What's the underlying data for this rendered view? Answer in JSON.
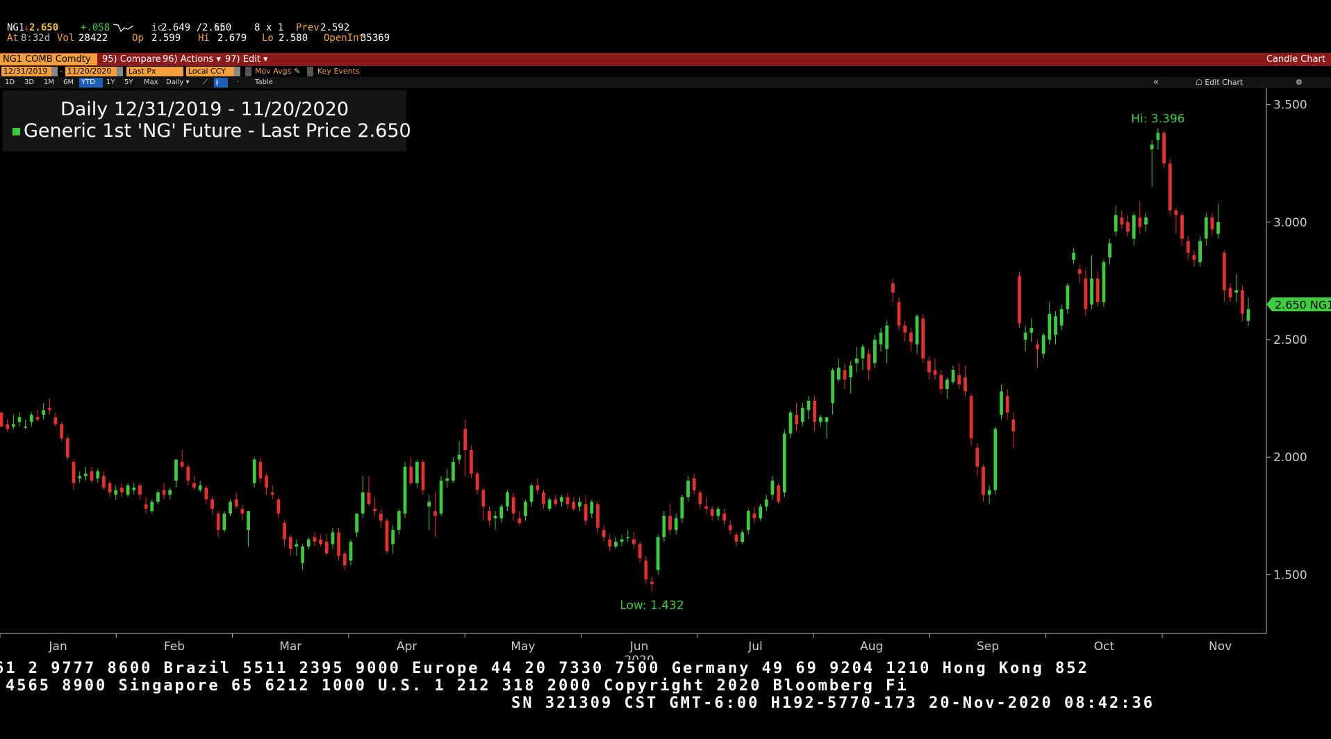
{
  "quote": {
    "ticker": "NG1",
    "arrow": "↓",
    "last": "2.650",
    "change": "+.058",
    "ic_label": "ic",
    "ic_value": "2.649 /2.650",
    "ic_suffix": "ic",
    "size": "8 x 1",
    "prev_label": "Prev",
    "prev": "2.592",
    "at_label": "At",
    "at": "8:32d",
    "vol_label": "Vol",
    "vol": "28422",
    "op_label": "Op",
    "op": "2.599",
    "hi_label": "Hi",
    "hi": "2.679",
    "lo_label": "Lo",
    "lo": "2.580",
    "oi_label": "OpenInt",
    "oi": "35369"
  },
  "toolbar": {
    "security": "NG1 COMB Comdty",
    "compare": "95) Compare",
    "actions": "96) Actions ▾",
    "edit": "97) Edit ▾",
    "chart_type": "Candle Chart",
    "start_date": "12/31/2019",
    "end_date": "11/20/2020",
    "price_field": "Last Px",
    "currency": "Local CCY",
    "mov_avgs": "Mov Avgs",
    "key_events": "Key Events",
    "periods": [
      "1D",
      "3D",
      "1M",
      "6M",
      "YTD",
      "1Y",
      "5Y",
      "Max"
    ],
    "frequency": "Daily ▾",
    "table": "Table",
    "collapse": "«",
    "edit_chart": "Edit Chart",
    "settings": "⚙"
  },
  "legend": {
    "line1": "Daily 12/31/2019 - 11/20/2020",
    "line2": "Generic 1st 'NG' Future - Last Price",
    "last": "2.650"
  },
  "footer": {
    "line1": "61 2 9777 8600 Brazil 5511 2395 9000 Europe 44 20 7330 7500 Germany 49 69 9204 1210 Hong Kong 852",
    "line2": "4565 8900     Singapore 65 6212 1000     U.S. 1 212 318 2000     Copyright 2020 Bloomberg Fi",
    "line3": "SN 321309 CST  GMT-6:00 H192-5770-173 20-Nov-2020 08:42:36"
  },
  "colors": {
    "up": "#3dcc3d",
    "down": "#e53030",
    "axis": "#bbbbbb",
    "background": "#000000"
  },
  "chart_data": {
    "type": "candlestick",
    "title": "Daily 12/31/2019 - 11/20/2020",
    "series_name": "Generic 1st 'NG' Future - Last Price",
    "ylim": [
      1.25,
      3.57
    ],
    "y_ticks": [
      "3.500",
      "3.000",
      "2.500",
      "2.000",
      "1.500"
    ],
    "x_months": [
      "Jan",
      "Feb",
      "Mar",
      "Apr",
      "May",
      "Jun",
      "Jul",
      "Aug",
      "Sep",
      "Oct",
      "Nov"
    ],
    "x_year": "2020",
    "hi_label": "Hi: 3.396",
    "low_label": "Low: 1.432",
    "last_label": "2.650 NG1",
    "last": 2.65,
    "candles": [
      [
        2.19,
        2.19,
        2.15,
        2.13
      ],
      [
        2.14,
        2.16,
        2.11,
        2.12
      ],
      [
        2.13,
        2.18,
        2.12,
        2.14
      ],
      [
        2.15,
        2.19,
        2.13,
        2.17
      ],
      [
        2.13,
        2.16,
        2.12,
        2.13
      ],
      [
        2.15,
        2.19,
        2.13,
        2.18
      ],
      [
        2.17,
        2.2,
        2.15,
        2.16
      ],
      [
        2.18,
        2.23,
        2.16,
        2.2
      ],
      [
        2.21,
        2.25,
        2.18,
        2.2
      ],
      [
        2.17,
        2.19,
        2.13,
        2.14
      ],
      [
        2.14,
        2.15,
        2.07,
        2.08
      ],
      [
        2.08,
        2.09,
        1.99,
        2.0
      ],
      [
        1.98,
        1.99,
        1.86,
        1.89
      ],
      [
        1.91,
        1.94,
        1.89,
        1.92
      ],
      [
        1.92,
        1.96,
        1.9,
        1.93
      ],
      [
        1.94,
        1.96,
        1.89,
        1.9
      ],
      [
        1.91,
        1.95,
        1.89,
        1.94
      ],
      [
        1.92,
        1.94,
        1.86,
        1.87
      ],
      [
        1.89,
        1.9,
        1.83,
        1.85
      ],
      [
        1.84,
        1.88,
        1.82,
        1.86
      ],
      [
        1.87,
        1.89,
        1.83,
        1.85
      ],
      [
        1.84,
        1.89,
        1.83,
        1.88
      ],
      [
        1.86,
        1.89,
        1.84,
        1.87
      ],
      [
        1.88,
        1.89,
        1.82,
        1.84
      ],
      [
        1.8,
        1.83,
        1.76,
        1.78
      ],
      [
        1.77,
        1.82,
        1.76,
        1.81
      ],
      [
        1.81,
        1.86,
        1.8,
        1.85
      ],
      [
        1.86,
        1.89,
        1.82,
        1.84
      ],
      [
        1.84,
        1.87,
        1.82,
        1.86
      ],
      [
        1.9,
        1.99,
        1.87,
        1.99
      ],
      [
        1.98,
        2.03,
        1.95,
        1.96
      ],
      [
        1.96,
        1.97,
        1.88,
        1.9
      ],
      [
        1.89,
        1.92,
        1.86,
        1.87
      ],
      [
        1.86,
        1.9,
        1.85,
        1.88
      ],
      [
        1.87,
        1.88,
        1.8,
        1.82
      ],
      [
        1.82,
        1.83,
        1.76,
        1.78
      ],
      [
        1.76,
        1.77,
        1.66,
        1.69
      ],
      [
        1.69,
        1.77,
        1.68,
        1.76
      ],
      [
        1.76,
        1.82,
        1.75,
        1.81
      ],
      [
        1.82,
        1.85,
        1.78,
        1.79
      ],
      [
        1.78,
        1.8,
        1.73,
        1.76
      ],
      [
        1.69,
        1.77,
        1.62,
        1.77
      ],
      [
        1.89,
        2.0,
        1.87,
        1.99
      ],
      [
        1.98,
        2.0,
        1.89,
        1.91
      ],
      [
        1.92,
        1.93,
        1.84,
        1.87
      ],
      [
        1.85,
        1.88,
        1.82,
        1.84
      ],
      [
        1.82,
        1.83,
        1.74,
        1.76
      ],
      [
        1.72,
        1.73,
        1.62,
        1.65
      ],
      [
        1.66,
        1.67,
        1.58,
        1.61
      ],
      [
        1.62,
        1.65,
        1.58,
        1.63
      ],
      [
        1.55,
        1.63,
        1.52,
        1.62
      ],
      [
        1.62,
        1.66,
        1.61,
        1.65
      ],
      [
        1.66,
        1.68,
        1.62,
        1.64
      ],
      [
        1.65,
        1.67,
        1.62,
        1.63
      ],
      [
        1.64,
        1.67,
        1.58,
        1.59
      ],
      [
        1.63,
        1.7,
        1.61,
        1.68
      ],
      [
        1.68,
        1.7,
        1.56,
        1.58
      ],
      [
        1.59,
        1.6,
        1.52,
        1.54
      ],
      [
        1.56,
        1.65,
        1.54,
        1.64
      ],
      [
        1.68,
        1.76,
        1.66,
        1.76
      ],
      [
        1.76,
        1.92,
        1.74,
        1.85
      ],
      [
        1.85,
        1.92,
        1.79,
        1.8
      ],
      [
        1.78,
        1.83,
        1.75,
        1.77
      ],
      [
        1.76,
        1.78,
        1.7,
        1.73
      ],
      [
        1.73,
        1.74,
        1.59,
        1.6
      ],
      [
        1.63,
        1.71,
        1.59,
        1.69
      ],
      [
        1.69,
        1.78,
        1.67,
        1.77
      ],
      [
        1.76,
        1.98,
        1.74,
        1.96
      ],
      [
        1.96,
        2.0,
        1.88,
        1.89
      ],
      [
        1.89,
        1.99,
        1.87,
        1.98
      ],
      [
        1.98,
        1.99,
        1.84,
        1.86
      ],
      [
        1.79,
        1.84,
        1.69,
        1.81
      ],
      [
        1.77,
        1.85,
        1.66,
        1.75
      ],
      [
        1.76,
        1.92,
        1.75,
        1.9
      ],
      [
        1.9,
        1.95,
        1.87,
        1.91
      ],
      [
        1.9,
        2.0,
        1.89,
        1.98
      ],
      [
        1.99,
        2.07,
        1.97,
        2.01
      ],
      [
        2.12,
        2.16,
        1.92,
        2.03
      ],
      [
        2.03,
        2.05,
        1.91,
        1.93
      ],
      [
        1.93,
        1.94,
        1.84,
        1.86
      ],
      [
        1.86,
        1.87,
        1.73,
        1.79
      ],
      [
        1.77,
        1.79,
        1.71,
        1.73
      ],
      [
        1.74,
        1.77,
        1.69,
        1.75
      ],
      [
        1.74,
        1.8,
        1.72,
        1.79
      ],
      [
        1.79,
        1.86,
        1.77,
        1.85
      ],
      [
        1.83,
        1.85,
        1.73,
        1.76
      ],
      [
        1.74,
        1.77,
        1.71,
        1.72
      ],
      [
        1.75,
        1.82,
        1.73,
        1.81
      ],
      [
        1.81,
        1.89,
        1.79,
        1.88
      ],
      [
        1.88,
        1.91,
        1.84,
        1.86
      ],
      [
        1.85,
        1.86,
        1.78,
        1.8
      ],
      [
        1.78,
        1.83,
        1.77,
        1.82
      ],
      [
        1.82,
        1.84,
        1.79,
        1.8
      ],
      [
        1.81,
        1.84,
        1.79,
        1.83
      ],
      [
        1.83,
        1.85,
        1.78,
        1.8
      ],
      [
        1.81,
        1.83,
        1.77,
        1.78
      ],
      [
        1.79,
        1.83,
        1.77,
        1.81
      ],
      [
        1.8,
        1.84,
        1.71,
        1.73
      ],
      [
        1.76,
        1.82,
        1.74,
        1.81
      ],
      [
        1.8,
        1.81,
        1.68,
        1.7
      ],
      [
        1.69,
        1.71,
        1.64,
        1.66
      ],
      [
        1.65,
        1.67,
        1.6,
        1.62
      ],
      [
        1.62,
        1.66,
        1.61,
        1.64
      ],
      [
        1.64,
        1.67,
        1.62,
        1.65
      ],
      [
        1.66,
        1.69,
        1.64,
        1.66
      ],
      [
        1.65,
        1.68,
        1.61,
        1.63
      ],
      [
        1.63,
        1.64,
        1.55,
        1.57
      ],
      [
        1.56,
        1.58,
        1.46,
        1.48
      ],
      [
        1.47,
        1.49,
        1.43,
        1.46
      ],
      [
        1.52,
        1.67,
        1.5,
        1.66
      ],
      [
        1.66,
        1.77,
        1.64,
        1.75
      ],
      [
        1.75,
        1.8,
        1.67,
        1.69
      ],
      [
        1.69,
        1.76,
        1.67,
        1.74
      ],
      [
        1.74,
        1.84,
        1.72,
        1.83
      ],
      [
        1.83,
        1.92,
        1.81,
        1.9
      ],
      [
        1.91,
        1.93,
        1.84,
        1.86
      ],
      [
        1.85,
        1.86,
        1.78,
        1.8
      ],
      [
        1.79,
        1.83,
        1.76,
        1.78
      ],
      [
        1.78,
        1.79,
        1.73,
        1.75
      ],
      [
        1.75,
        1.79,
        1.73,
        1.78
      ],
      [
        1.76,
        1.78,
        1.71,
        1.73
      ],
      [
        1.71,
        1.73,
        1.67,
        1.69
      ],
      [
        1.67,
        1.68,
        1.62,
        1.64
      ],
      [
        1.64,
        1.69,
        1.63,
        1.68
      ],
      [
        1.69,
        1.78,
        1.67,
        1.77
      ],
      [
        1.76,
        1.79,
        1.72,
        1.74
      ],
      [
        1.74,
        1.8,
        1.73,
        1.79
      ],
      [
        1.79,
        1.84,
        1.77,
        1.82
      ],
      [
        1.84,
        1.92,
        1.82,
        1.9
      ],
      [
        1.88,
        1.89,
        1.8,
        1.81
      ],
      [
        1.85,
        2.12,
        1.83,
        2.1
      ],
      [
        2.1,
        2.2,
        2.08,
        2.19
      ],
      [
        2.18,
        2.23,
        2.11,
        2.14
      ],
      [
        2.15,
        2.23,
        2.13,
        2.21
      ],
      [
        2.2,
        2.26,
        2.16,
        2.24
      ],
      [
        2.24,
        2.26,
        2.11,
        2.15
      ],
      [
        2.15,
        2.18,
        2.13,
        2.17
      ],
      [
        2.15,
        2.16,
        2.08,
        2.17
      ],
      [
        2.23,
        2.38,
        2.18,
        2.37
      ],
      [
        2.33,
        2.42,
        2.32,
        2.38
      ],
      [
        2.37,
        2.4,
        2.29,
        2.33
      ],
      [
        2.34,
        2.41,
        2.27,
        2.39
      ],
      [
        2.4,
        2.47,
        2.36,
        2.42
      ],
      [
        2.42,
        2.48,
        2.37,
        2.47
      ],
      [
        2.44,
        2.46,
        2.33,
        2.37
      ],
      [
        2.4,
        2.52,
        2.38,
        2.5
      ],
      [
        2.48,
        2.55,
        2.45,
        2.53
      ],
      [
        2.46,
        2.58,
        2.4,
        2.56
      ],
      [
        2.74,
        2.76,
        2.66,
        2.7
      ],
      [
        2.66,
        2.68,
        2.54,
        2.56
      ],
      [
        2.56,
        2.58,
        2.49,
        2.53
      ],
      [
        2.53,
        2.55,
        2.45,
        2.49
      ],
      [
        2.48,
        2.61,
        2.44,
        2.6
      ],
      [
        2.59,
        2.61,
        2.4,
        2.42
      ],
      [
        2.41,
        2.43,
        2.33,
        2.36
      ],
      [
        2.37,
        2.42,
        2.33,
        2.35
      ],
      [
        2.35,
        2.37,
        2.27,
        2.29
      ],
      [
        2.29,
        2.34,
        2.25,
        2.33
      ],
      [
        2.32,
        2.39,
        2.31,
        2.37
      ],
      [
        2.35,
        2.4,
        2.29,
        2.31
      ],
      [
        2.34,
        2.39,
        2.26,
        2.28
      ],
      [
        2.26,
        2.27,
        2.05,
        2.08
      ],
      [
        2.04,
        2.06,
        1.92,
        1.96
      ],
      [
        1.96,
        1.97,
        1.81,
        1.84
      ],
      [
        1.84,
        1.88,
        1.8,
        1.86
      ],
      [
        1.86,
        2.13,
        1.84,
        2.12
      ],
      [
        2.18,
        2.31,
        2.16,
        2.28
      ],
      [
        2.26,
        2.29,
        2.16,
        2.19
      ],
      [
        2.16,
        2.19,
        2.04,
        2.11
      ],
      [
        2.77,
        2.79,
        2.55,
        2.57
      ],
      [
        2.5,
        2.56,
        2.45,
        2.53
      ],
      [
        2.53,
        2.59,
        2.49,
        2.55
      ],
      [
        2.48,
        2.5,
        2.38,
        2.46
      ],
      [
        2.44,
        2.53,
        2.42,
        2.52
      ],
      [
        2.5,
        2.66,
        2.48,
        2.61
      ],
      [
        2.52,
        2.62,
        2.48,
        2.6
      ],
      [
        2.56,
        2.65,
        2.54,
        2.63
      ],
      [
        2.63,
        2.74,
        2.61,
        2.73
      ],
      [
        2.84,
        2.89,
        2.82,
        2.87
      ],
      [
        2.8,
        2.82,
        2.74,
        2.78
      ],
      [
        2.76,
        2.8,
        2.6,
        2.63
      ],
      [
        2.65,
        2.86,
        2.63,
        2.76
      ],
      [
        2.76,
        2.79,
        2.64,
        2.66
      ],
      [
        2.66,
        2.84,
        2.64,
        2.83
      ],
      [
        2.85,
        2.93,
        2.82,
        2.91
      ],
      [
        2.96,
        3.07,
        2.94,
        3.03
      ],
      [
        3.02,
        3.05,
        2.97,
        2.99
      ],
      [
        3.0,
        3.03,
        2.94,
        2.96
      ],
      [
        2.93,
        3.04,
        2.9,
        3.03
      ],
      [
        3.02,
        3.09,
        2.95,
        2.98
      ],
      [
        2.99,
        3.04,
        2.96,
        3.02
      ],
      [
        3.31,
        3.35,
        3.15,
        3.33
      ],
      [
        3.35,
        3.4,
        3.31,
        3.38
      ],
      [
        3.38,
        3.39,
        3.23,
        3.25
      ],
      [
        3.25,
        3.27,
        3.03,
        3.05
      ],
      [
        3.05,
        3.06,
        2.95,
        3.03
      ],
      [
        3.03,
        3.04,
        2.9,
        2.93
      ],
      [
        2.92,
        2.94,
        2.84,
        2.87
      ],
      [
        2.86,
        2.88,
        2.81,
        2.84
      ],
      [
        2.83,
        2.94,
        2.81,
        2.92
      ],
      [
        2.93,
        3.04,
        2.9,
        3.02
      ],
      [
        3.02,
        3.04,
        2.94,
        2.97
      ],
      [
        2.95,
        3.08,
        2.93,
        3.0
      ],
      [
        2.87,
        2.88,
        2.66,
        2.71
      ],
      [
        2.72,
        2.74,
        2.66,
        2.68
      ],
      [
        2.7,
        2.78,
        2.66,
        2.71
      ],
      [
        2.71,
        2.73,
        2.58,
        2.61
      ],
      [
        2.58,
        2.68,
        2.56,
        2.63
      ]
    ]
  }
}
